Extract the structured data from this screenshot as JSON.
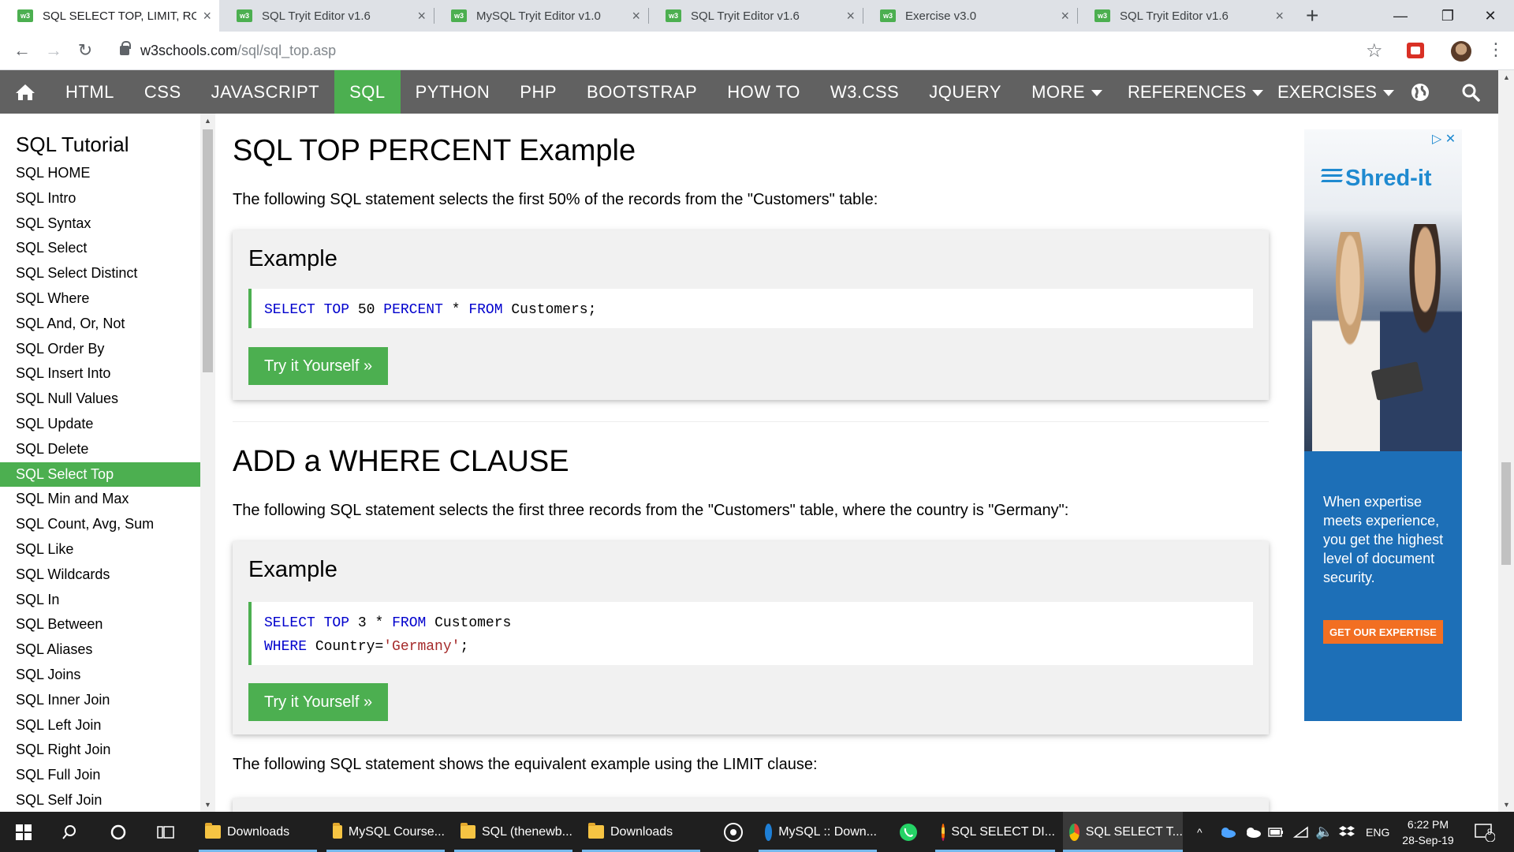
{
  "browser": {
    "tabs": [
      {
        "title": "SQL SELECT TOP, LIMIT, ROW",
        "active": true
      },
      {
        "title": "SQL Tryit Editor v1.6",
        "active": false
      },
      {
        "title": "MySQL Tryit Editor v1.0",
        "active": false
      },
      {
        "title": "SQL Tryit Editor v1.6",
        "active": false
      },
      {
        "title": "Exercise v3.0",
        "active": false
      },
      {
        "title": "SQL Tryit Editor v1.6",
        "active": false
      }
    ],
    "favicon_text": "w3",
    "url_host": "w3schools.com",
    "url_path": "/sql/sql_top.asp"
  },
  "topnav": {
    "items": [
      "HTML",
      "CSS",
      "JAVASCRIPT",
      "SQL",
      "PYTHON",
      "PHP",
      "BOOTSTRAP",
      "HOW TO",
      "W3.CSS",
      "JQUERY",
      "MORE"
    ],
    "active": "SQL",
    "references": "REFERENCES",
    "exercises": "EXERCISES"
  },
  "sidebar": {
    "heading": "SQL Tutorial",
    "items": [
      "SQL HOME",
      "SQL Intro",
      "SQL Syntax",
      "SQL Select",
      "SQL Select Distinct",
      "SQL Where",
      "SQL And, Or, Not",
      "SQL Order By",
      "SQL Insert Into",
      "SQL Null Values",
      "SQL Update",
      "SQL Delete",
      "SQL Select Top",
      "SQL Min and Max",
      "SQL Count, Avg, Sum",
      "SQL Like",
      "SQL Wildcards",
      "SQL In",
      "SQL Between",
      "SQL Aliases",
      "SQL Joins",
      "SQL Inner Join",
      "SQL Left Join",
      "SQL Right Join",
      "SQL Full Join",
      "SQL Self Join"
    ],
    "active_index": 12
  },
  "main": {
    "section1": {
      "heading": "SQL TOP PERCENT Example",
      "desc": "The following SQL statement selects the first 50% of the records from the \"Customers\" table:",
      "example_label": "Example",
      "code": {
        "kw1": "SELECT",
        "kw2": "TOP",
        "num": "50",
        "kw3": "PERCENT",
        "star": "*",
        "kw4": "FROM",
        "rest": "Customers;"
      },
      "button": "Try it Yourself »"
    },
    "section2": {
      "heading": "ADD a WHERE CLAUSE",
      "desc": "The following SQL statement selects the first three records from the \"Customers\" table, where the country is \"Germany\":",
      "example_label": "Example",
      "code": {
        "kw1": "SELECT",
        "kw2": "TOP",
        "num": "3",
        "star": "*",
        "kw3": "FROM",
        "table": "Customers",
        "kw4": "WHERE",
        "cond": "Country=",
        "str": "'Germany'",
        "end": ";"
      },
      "button": "Try it Yourself »"
    },
    "section3": {
      "desc": "The following SQL statement shows the equivalent example using the LIMIT clause:"
    }
  },
  "ad": {
    "brand": "Shred-it",
    "text": "When expertise meets experience, you get the highest level of document security.",
    "cta": "GET OUR EXPERTISE"
  },
  "taskbar": {
    "apps": [
      {
        "label": "Downloads",
        "kind": "folder"
      },
      {
        "label": "MySQL Course...",
        "kind": "folder"
      },
      {
        "label": "SQL (thenewb...",
        "kind": "folder"
      },
      {
        "label": "Downloads",
        "kind": "folder"
      },
      {
        "label": "MySQL :: Down...",
        "kind": "edge"
      },
      {
        "label": "SQL SELECT DI...",
        "kind": "firefox"
      },
      {
        "label": "SQL SELECT T...",
        "kind": "chrome"
      }
    ],
    "language": "ENG",
    "time": "6:22 PM",
    "date": "28-Sep-19",
    "notifications": "9"
  },
  "colors": {
    "w3_green": "#4caf50",
    "nav_gray": "#616161",
    "keyword_blue": "#0000cd",
    "string_brown": "#a52a2a"
  }
}
